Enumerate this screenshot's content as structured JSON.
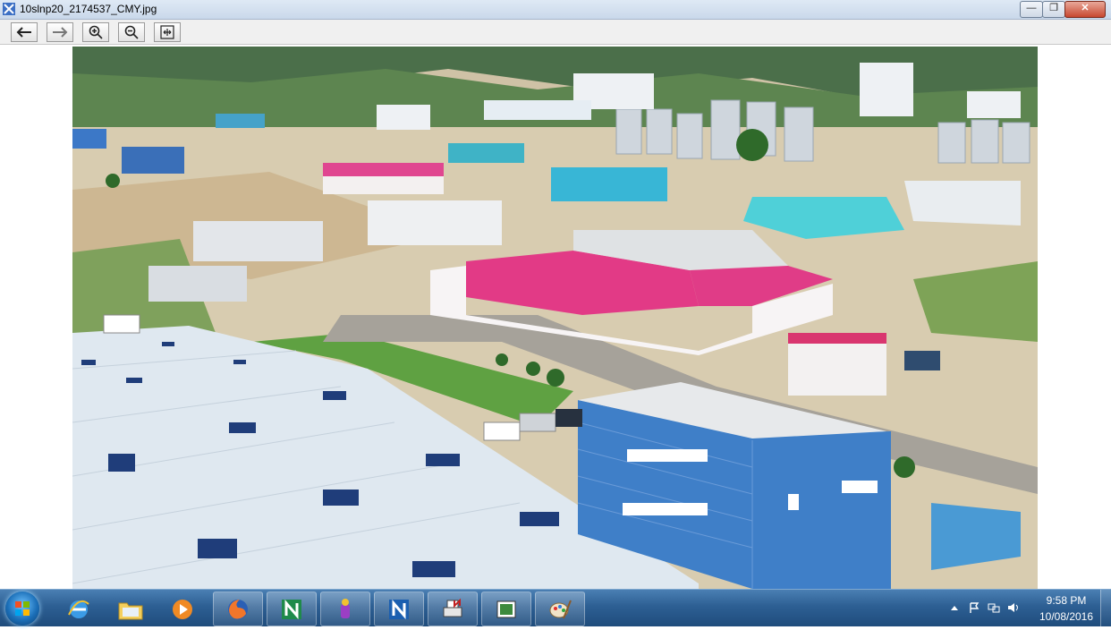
{
  "window": {
    "title": "10slnp20_2174537_CMY.jpg",
    "minimize_label": "—",
    "maximize_label": "❐",
    "close_label": "✕"
  },
  "toolbar": {
    "buttons": [
      {
        "name": "back",
        "icon": "arrow-left-icon"
      },
      {
        "name": "forward",
        "icon": "arrow-right-icon"
      },
      {
        "name": "zoom-in",
        "icon": "zoom-in-icon"
      },
      {
        "name": "zoom-out",
        "icon": "zoom-out-icon"
      },
      {
        "name": "fit",
        "icon": "fit-window-icon"
      }
    ]
  },
  "image": {
    "subject": "aerial-industrial-estate-photo"
  },
  "taskbar": {
    "pinned": [
      {
        "name": "internet-explorer",
        "icon": "ie-icon"
      },
      {
        "name": "file-explorer",
        "icon": "folder-icon"
      },
      {
        "name": "media-player",
        "icon": "media-player-icon"
      },
      {
        "name": "firefox",
        "icon": "firefox-icon"
      },
      {
        "name": "n-app-green",
        "icon": "n-green-icon"
      },
      {
        "name": "installer",
        "icon": "installer-icon"
      },
      {
        "name": "n-app-blue",
        "icon": "n-blue-icon"
      },
      {
        "name": "n-printer",
        "icon": "n-printer-icon"
      },
      {
        "name": "viewer",
        "icon": "viewer-icon"
      },
      {
        "name": "paint",
        "icon": "paint-icon"
      }
    ],
    "clock": {
      "time": "9:58 PM",
      "date": "10/08/2016"
    }
  },
  "colors": {
    "taskbar": "#2d5f93",
    "roof_pink": "#e23a86",
    "roof_cyan": "#4fd0d8",
    "roof_white": "#dfe8f0"
  }
}
